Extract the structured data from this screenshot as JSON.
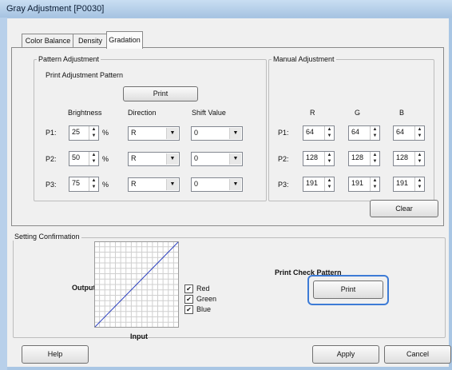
{
  "window": {
    "title": "Gray Adjustment [P0030]"
  },
  "tabs": [
    "Color Balance",
    "Density",
    "Gradation"
  ],
  "pattern": {
    "group_label": "Pattern Adjustment",
    "print_pattern_label": "Print Adjustment Pattern",
    "print_button": "Print",
    "headers": {
      "brightness": "Brightness",
      "direction": "Direction",
      "shift": "Shift Value"
    },
    "pct": "%",
    "rows": [
      {
        "label": "P1:",
        "brightness": "25",
        "direction": "R",
        "shift": "0"
      },
      {
        "label": "P2:",
        "brightness": "50",
        "direction": "R",
        "shift": "0"
      },
      {
        "label": "P3:",
        "brightness": "75",
        "direction": "R",
        "shift": "0"
      }
    ]
  },
  "manual": {
    "group_label": "Manual Adjustment",
    "headers": {
      "r": "R",
      "g": "G",
      "b": "B"
    },
    "rows": [
      {
        "label": "P1:",
        "r": "64",
        "g": "64",
        "b": "64"
      },
      {
        "label": "P2:",
        "r": "128",
        "g": "128",
        "b": "128"
      },
      {
        "label": "P3:",
        "r": "191",
        "g": "191",
        "b": "191"
      }
    ],
    "clear_button": "Clear"
  },
  "confirm": {
    "group_label": "Setting Confirmation",
    "output_label": "Output",
    "input_label": "Input",
    "checks": [
      {
        "label": "Red",
        "checked": true
      },
      {
        "label": "Green",
        "checked": true
      },
      {
        "label": "Blue",
        "checked": true
      }
    ],
    "check_pattern_label": "Print Check Pattern",
    "print_button": "Print"
  },
  "footer": {
    "help": "Help",
    "apply": "Apply",
    "cancel": "Cancel"
  },
  "colors": {
    "curve": "#2b3fbf",
    "focus_ring": "#3d7bd6"
  }
}
